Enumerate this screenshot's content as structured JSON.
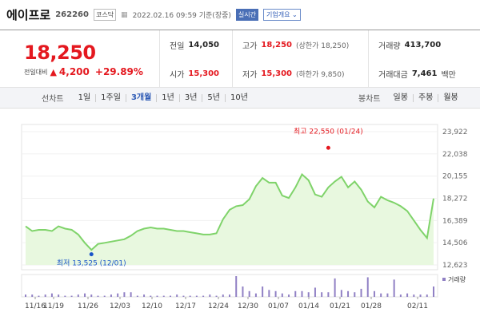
{
  "header": {
    "name": "에이프로",
    "code": "262260",
    "market": "코스닥",
    "datetime": "2022.02.16 09:59 기준(장중)",
    "realtime_label": "실시간",
    "company_info_label": "기업개요 ⌄"
  },
  "price": {
    "current": "18,250",
    "change_label": "전일대비",
    "change_value": "4,200",
    "change_pct": "+29.89%"
  },
  "stats": {
    "prev_close_label": "전일",
    "prev_close": "14,050",
    "high_label": "고가",
    "high": "18,250",
    "high_sub": "(상한가 18,250)",
    "volume_label": "거래량",
    "volume": "413,700",
    "open_label": "시가",
    "open": "15,300",
    "low_label": "저가",
    "low": "15,300",
    "low_sub": "(하한가 9,850)",
    "amount_label": "거래대금",
    "amount": "7,461",
    "amount_unit": "백만"
  },
  "periods": {
    "label": "선차트",
    "items": [
      "1일",
      "1주일",
      "3개월",
      "1년",
      "3년",
      "5년",
      "10년"
    ],
    "active": "3개월",
    "candle_label": "봉차트",
    "candle_items": [
      "일봉",
      "주봉",
      "월봉"
    ]
  },
  "colors": {
    "up": "#e4181f",
    "down": "#1753c9",
    "line": "#7fd36a",
    "fill": "#e8f8df",
    "volume": "#9080c4"
  },
  "chart_data": {
    "type": "area",
    "y_ticks": [
      "23,922",
      "22,038",
      "20,155",
      "18,272",
      "16,389",
      "14,506",
      "12,623"
    ],
    "ylim": [
      12623,
      23922
    ],
    "x_ticks": [
      "11/16",
      "11/19",
      "11/26",
      "12/03",
      "12/10",
      "12/17",
      "12/24",
      "12/30",
      "01/07",
      "01/14",
      "01/21",
      "01/28",
      "02/11"
    ],
    "high_annotation": "최고 22,550 (01/24)",
    "low_annotation": "최저 13,525 (12/01)",
    "high_point": {
      "date": "01/24",
      "value": 22550
    },
    "low_point": {
      "date": "12/01",
      "value": 13525
    },
    "volume_label": "거래량",
    "series": [
      {
        "values": [
          15900,
          15500,
          15600,
          15600,
          15500,
          15900,
          15700,
          15600,
          15200,
          14500,
          13900,
          14400,
          14500,
          14600,
          14700,
          14800,
          15100,
          15500,
          15700,
          15800,
          15700,
          15700,
          15600,
          15500,
          15500,
          15400,
          15300,
          15200,
          15200,
          15300,
          16500,
          17300,
          17600,
          17700,
          18200,
          19300,
          20000,
          19600,
          19600,
          18500,
          18300,
          19200,
          20300,
          19800,
          18600,
          18400,
          19200,
          19700,
          20100,
          19200,
          19700,
          19000,
          18000,
          17500,
          18400,
          18100,
          17900,
          17600,
          17200,
          16400,
          15600,
          14900,
          18250
        ]
      }
    ],
    "volume": [
      2,
      2,
      1,
      2,
      3,
      2,
      1,
      1,
      2,
      3,
      2,
      1,
      1,
      2,
      3,
      4,
      4,
      1,
      2,
      1,
      1,
      1,
      1,
      2,
      1,
      1,
      1,
      1,
      2,
      1,
      2,
      2,
      18,
      9,
      5,
      3,
      9,
      6,
      5,
      3,
      2,
      5,
      5,
      4,
      8,
      4,
      4,
      16,
      6,
      5,
      4,
      7,
      17,
      5,
      3,
      3,
      15,
      2,
      3,
      2,
      2,
      2,
      9
    ]
  }
}
